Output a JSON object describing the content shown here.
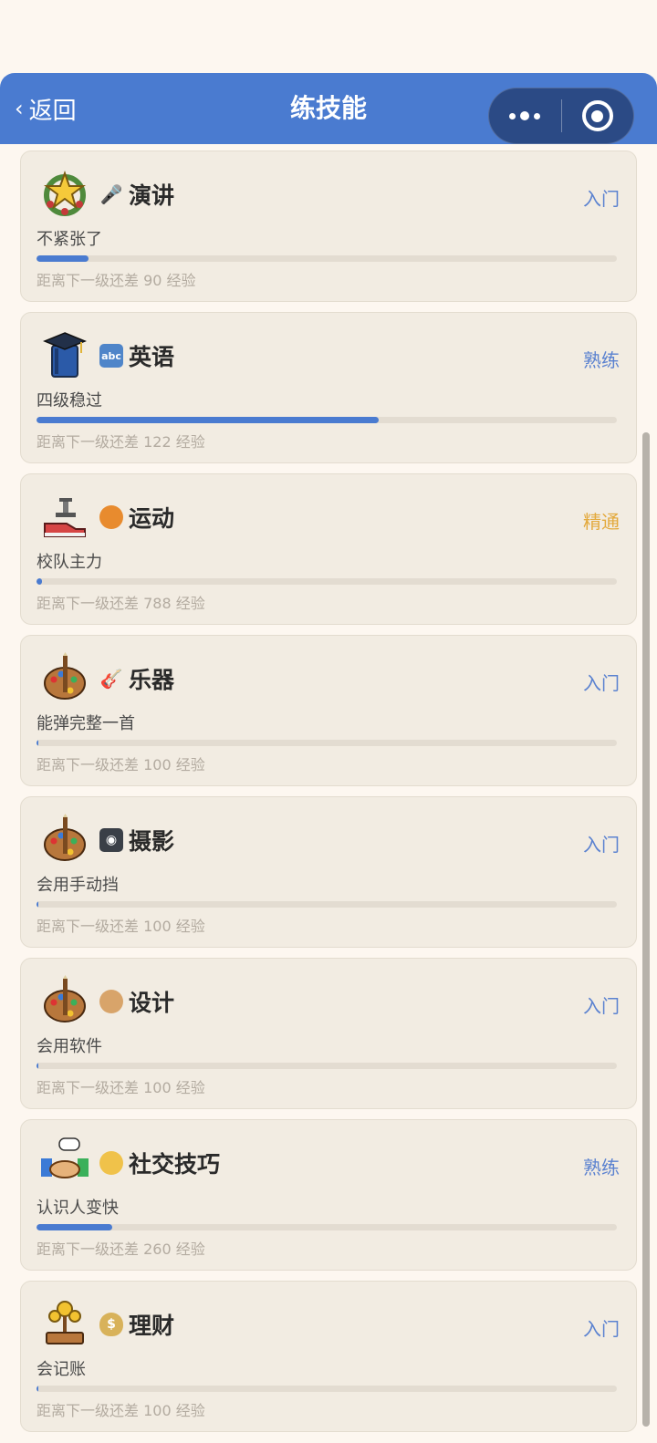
{
  "nav": {
    "back_label": "返回",
    "title": "练技能"
  },
  "skills": [
    {
      "name": "演讲",
      "icon": "microphone-icon",
      "level": "入门",
      "level_color": "#5b82d0",
      "desc": "不紧张了",
      "progress": 0.09,
      "hint": "距离下一级还差 90 经验"
    },
    {
      "name": "英语",
      "icon": "abc-icon",
      "level": "熟练",
      "level_color": "#5b82d0",
      "desc": "四级稳过",
      "progress": 0.59,
      "hint": "距离下一级还差 122 经验"
    },
    {
      "name": "运动",
      "icon": "basketball-icon",
      "level": "精通",
      "level_color": "#e3a93c",
      "desc": " 校队主力",
      "progress": 0.01,
      "hint": "距离下一级还差 788 经验"
    },
    {
      "name": "乐器",
      "icon": "guitar-icon",
      "level": "入门",
      "level_color": "#5b82d0",
      "desc": "能弹完整一首",
      "progress": 0.003,
      "hint": "距离下一级还差 100 经验"
    },
    {
      "name": "摄影",
      "icon": "camera-icon",
      "level": "入门",
      "level_color": "#5b82d0",
      "desc": "会用手动挡",
      "progress": 0.003,
      "hint": "距离下一级还差 100 经验"
    },
    {
      "name": "设计",
      "icon": "palette-icon",
      "level": "入门",
      "level_color": "#5b82d0",
      "desc": "会用软件",
      "progress": 0.003,
      "hint": "距离下一级还差 100 经验"
    },
    {
      "name": "社交技巧",
      "icon": "handshake-icon",
      "level": "熟练",
      "level_color": "#5b82d0",
      "desc": "认识人变快",
      "progress": 0.13,
      "hint": "距离下一级还差 260 经验"
    },
    {
      "name": "理财",
      "icon": "money-bag-icon",
      "level": "入门",
      "level_color": "#5b82d0",
      "desc": "会记账",
      "progress": 0.003,
      "hint": "距离下一级还差 100 经验"
    }
  ]
}
